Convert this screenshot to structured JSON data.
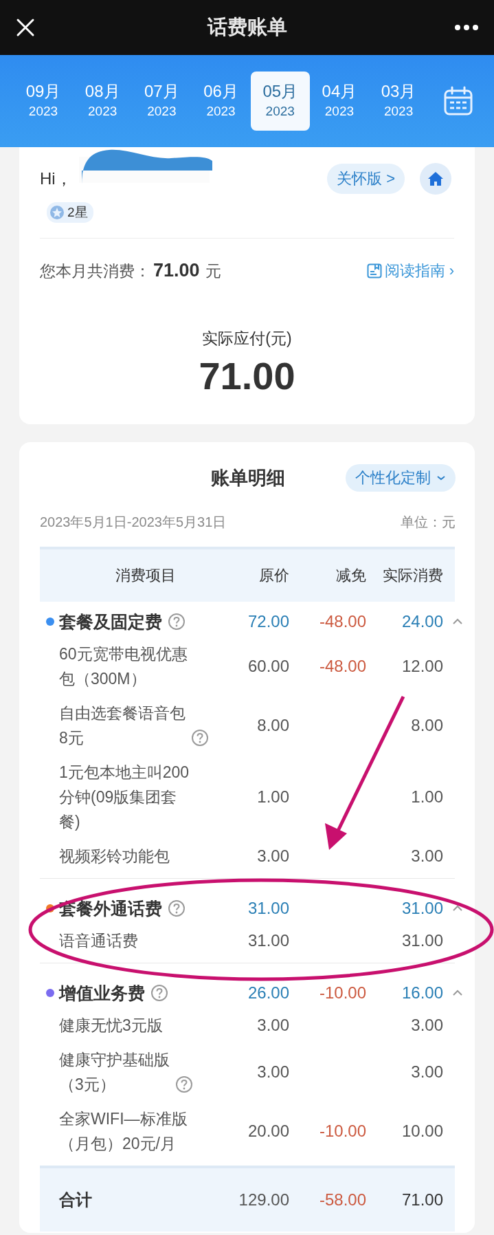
{
  "header": {
    "title": "话费账单"
  },
  "months": [
    {
      "month": "09月",
      "year": "2023",
      "selected": false
    },
    {
      "month": "08月",
      "year": "2023",
      "selected": false
    },
    {
      "month": "07月",
      "year": "2023",
      "selected": false
    },
    {
      "month": "06月",
      "year": "2023",
      "selected": false
    },
    {
      "month": "05月",
      "year": "2023",
      "selected": true
    },
    {
      "month": "04月",
      "year": "2023",
      "selected": false
    },
    {
      "month": "03月",
      "year": "2023",
      "selected": false
    }
  ],
  "summary": {
    "greeting": "Hi，",
    "care_button": "关怀版 >",
    "level_badge": "2星",
    "spend_label": "您本月共消费：",
    "spend_amount": "71.00",
    "spend_unit": "元",
    "guide_link": "阅读指南 ›",
    "payable_label": "实际应付(元)",
    "payable_amount": "71.00"
  },
  "details": {
    "title": "账单明细",
    "customize_button": "个性化定制",
    "period": "2023年5月1日-2023年5月31日",
    "unit": "单位：元",
    "columns": [
      "消费项目",
      "原价",
      "减免",
      "实际消费"
    ],
    "groups": [
      {
        "name": "套餐及固定费",
        "color": "#3b8ff0",
        "help": true,
        "expanded": true,
        "original": "72.00",
        "discount": "-48.00",
        "actual": "24.00",
        "items": [
          {
            "name": [
              "60元宽带电视优惠",
              "包（300M）"
            ],
            "help": false,
            "original": "60.00",
            "discount": "-48.00",
            "actual": "12.00"
          },
          {
            "name": [
              "自由选套餐语音包",
              "8元"
            ],
            "help": true,
            "original": "8.00",
            "actual": "8.00"
          },
          {
            "name": [
              "1元包本地主叫200",
              "分钟(09版集团套",
              "餐)"
            ],
            "help": false,
            "original": "1.00",
            "actual": "1.00"
          },
          {
            "name": [
              "视频彩铃功能包"
            ],
            "help": false,
            "original": "3.00",
            "actual": "3.00"
          }
        ]
      },
      {
        "name": "套餐外通话费",
        "color": "#f07a2a",
        "help": true,
        "expanded": true,
        "original": "31.00",
        "actual": "31.00",
        "items": [
          {
            "name": [
              "语音通话费"
            ],
            "help": false,
            "original": "31.00",
            "actual": "31.00"
          }
        ]
      },
      {
        "name": "增值业务费",
        "color": "#7b6cf0",
        "help": true,
        "expanded": true,
        "original": "26.00",
        "discount": "-10.00",
        "actual": "16.00",
        "items": [
          {
            "name": [
              "健康无忧3元版"
            ],
            "help": false,
            "original": "3.00",
            "actual": "3.00"
          },
          {
            "name": [
              "健康守护基础版",
              "（3元）"
            ],
            "help": true,
            "original": "3.00",
            "actual": "3.00"
          },
          {
            "name": [
              "全家WIFI—标准版",
              "（月包）20元/月"
            ],
            "help": false,
            "original": "20.00",
            "discount": "-10.00",
            "actual": "10.00"
          }
        ]
      }
    ],
    "total": {
      "label": "合计",
      "original": "129.00",
      "discount": "-58.00",
      "actual": "71.00"
    }
  }
}
